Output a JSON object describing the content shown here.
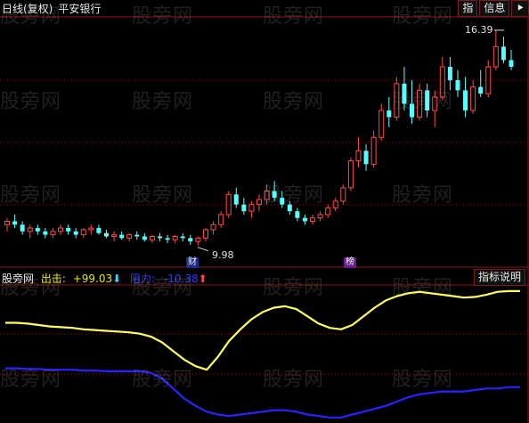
{
  "header": {
    "period": "日线(复权)",
    "stock": "平安银行"
  },
  "toolbar": {
    "zhi": "指",
    "info": "信息",
    "arrow": "⯈"
  },
  "price": {
    "high": "16.39",
    "low": "9.98"
  },
  "tags": {
    "cai": "财",
    "bang": "榜"
  },
  "indicator": {
    "name": "股旁网",
    "out_label": "出击:",
    "out_value": "+99.03",
    "res_label": "阻力:",
    "res_value": "-10.38",
    "explain_button": "指标说明"
  },
  "watermark": "股旁网",
  "colors": {
    "up": "#ff4a4a",
    "down": "#54ffff",
    "line_out": "#ffff60",
    "line_res": "#2a22ff",
    "grid": "#8a1414"
  },
  "chart_data": {
    "type": "candlestick",
    "price_high_label": 16.39,
    "price_low_label": 9.98,
    "candles": [
      [
        10.6,
        10.8,
        10.4,
        10.7
      ],
      [
        10.7,
        10.9,
        10.5,
        10.6
      ],
      [
        10.6,
        10.7,
        10.3,
        10.4
      ],
      [
        10.4,
        10.6,
        10.2,
        10.5
      ],
      [
        10.5,
        10.6,
        10.3,
        10.4
      ],
      [
        10.4,
        10.5,
        10.2,
        10.3
      ],
      [
        10.3,
        10.5,
        10.2,
        10.4
      ],
      [
        10.4,
        10.6,
        10.3,
        10.5
      ],
      [
        10.5,
        10.6,
        10.3,
        10.4
      ],
      [
        10.4,
        10.5,
        10.2,
        10.3
      ],
      [
        10.3,
        10.5,
        10.2,
        10.45
      ],
      [
        10.45,
        10.6,
        10.3,
        10.5
      ],
      [
        10.5,
        10.6,
        10.3,
        10.35
      ],
      [
        10.35,
        10.45,
        10.2,
        10.25
      ],
      [
        10.25,
        10.4,
        10.1,
        10.3
      ],
      [
        10.3,
        10.4,
        10.15,
        10.2
      ],
      [
        10.2,
        10.35,
        10.1,
        10.3
      ],
      [
        10.3,
        10.4,
        10.15,
        10.25
      ],
      [
        10.25,
        10.35,
        10.1,
        10.15
      ],
      [
        10.15,
        10.3,
        10.05,
        10.25
      ],
      [
        10.25,
        10.35,
        10.1,
        10.2
      ],
      [
        10.2,
        10.3,
        10.05,
        10.15
      ],
      [
        10.15,
        10.3,
        10.05,
        10.25
      ],
      [
        10.25,
        10.35,
        10.1,
        10.2
      ],
      [
        10.2,
        10.3,
        10.0,
        10.1
      ],
      [
        10.1,
        10.25,
        9.98,
        10.2
      ],
      [
        10.2,
        10.5,
        10.1,
        10.45
      ],
      [
        10.45,
        10.7,
        10.3,
        10.6
      ],
      [
        10.6,
        11.0,
        10.5,
        10.9
      ],
      [
        10.9,
        11.6,
        10.8,
        11.5
      ],
      [
        11.5,
        11.7,
        11.1,
        11.2
      ],
      [
        11.2,
        11.4,
        10.9,
        11.0
      ],
      [
        11.0,
        11.3,
        10.8,
        11.2
      ],
      [
        11.2,
        11.5,
        11.0,
        11.35
      ],
      [
        11.35,
        11.8,
        11.2,
        11.6
      ],
      [
        11.6,
        11.9,
        11.3,
        11.4
      ],
      [
        11.4,
        11.6,
        11.1,
        11.2
      ],
      [
        11.2,
        11.3,
        10.9,
        11.0
      ],
      [
        11.0,
        11.1,
        10.7,
        10.8
      ],
      [
        10.8,
        10.9,
        10.6,
        10.7
      ],
      [
        10.7,
        10.9,
        10.6,
        10.8
      ],
      [
        10.8,
        11.0,
        10.7,
        10.9
      ],
      [
        10.9,
        11.2,
        10.8,
        11.1
      ],
      [
        11.1,
        11.4,
        11.0,
        11.3
      ],
      [
        11.3,
        11.8,
        11.2,
        11.7
      ],
      [
        11.7,
        12.6,
        11.6,
        12.5
      ],
      [
        12.5,
        13.2,
        12.3,
        12.8
      ],
      [
        12.8,
        13.0,
        12.2,
        12.4
      ],
      [
        12.4,
        13.4,
        12.3,
        13.2
      ],
      [
        13.2,
        14.2,
        13.1,
        14.0
      ],
      [
        14.0,
        14.4,
        13.5,
        13.8
      ],
      [
        13.8,
        15.0,
        13.7,
        14.8
      ],
      [
        14.8,
        15.3,
        14.0,
        14.2
      ],
      [
        14.2,
        14.9,
        13.6,
        13.8
      ],
      [
        13.8,
        14.8,
        13.7,
        14.6
      ],
      [
        14.6,
        14.8,
        13.8,
        14.0
      ],
      [
        14.0,
        14.6,
        13.5,
        14.4
      ],
      [
        14.4,
        15.6,
        14.3,
        15.3
      ],
      [
        15.3,
        15.6,
        14.6,
        14.9
      ],
      [
        14.9,
        15.2,
        14.4,
        14.6
      ],
      [
        14.6,
        15.0,
        13.8,
        14.0
      ],
      [
        14.0,
        14.9,
        13.9,
        14.7
      ],
      [
        14.7,
        15.2,
        14.4,
        14.5
      ],
      [
        14.5,
        15.5,
        14.4,
        15.3
      ],
      [
        15.3,
        16.39,
        15.2,
        15.9
      ],
      [
        15.9,
        16.2,
        15.4,
        15.5
      ],
      [
        15.5,
        15.8,
        15.2,
        15.3
      ]
    ],
    "series": [
      {
        "name": "出击",
        "values": [
          55,
          55,
          54,
          52,
          50,
          49,
          48,
          46,
          45,
          44,
          43,
          42,
          40,
          36,
          28,
          16,
          4,
          -5,
          -10,
          8,
          30,
          46,
          60,
          70,
          76,
          78,
          74,
          64,
          54,
          48,
          46,
          52,
          64,
          76,
          86,
          92,
          96,
          98,
          96,
          94,
          92,
          90,
          91,
          94,
          98,
          99,
          99
        ]
      },
      {
        "name": "阻力",
        "values": [
          -8,
          -8,
          -9,
          -9,
          -10,
          -10,
          -10,
          -11,
          -11,
          -12,
          -12,
          -12,
          -12,
          -14,
          -22,
          -36,
          -50,
          -60,
          -68,
          -72,
          -74,
          -72,
          -70,
          -68,
          -66,
          -66,
          -68,
          -72,
          -74,
          -76,
          -76,
          -72,
          -68,
          -64,
          -60,
          -54,
          -48,
          -44,
          -42,
          -40,
          -40,
          -40,
          -38,
          -36,
          -36,
          -34,
          -34
        ]
      }
    ]
  }
}
